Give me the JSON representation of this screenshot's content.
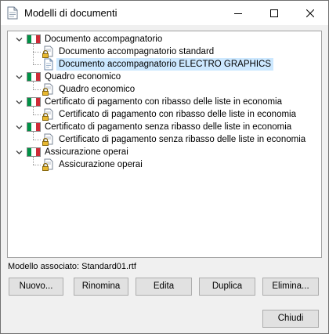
{
  "window": {
    "title": "Modelli di documenti",
    "icons": {
      "app": "document-icon",
      "minimize": "minimize-icon",
      "maximize": "maximize-icon",
      "close": "close-icon"
    }
  },
  "tree": {
    "groups": [
      {
        "label": "Documento accompagnatorio",
        "expanded": true,
        "children": [
          {
            "label": "Documento accompagnatorio standard",
            "icon": "locked-document-icon",
            "selected": false
          },
          {
            "label": "Documento accompagnatorio ELECTRO GRAPHICS",
            "icon": "document-icon",
            "selected": true
          }
        ]
      },
      {
        "label": "Quadro economico",
        "expanded": true,
        "children": [
          {
            "label": "Quadro economico",
            "icon": "locked-document-icon",
            "selected": false
          }
        ]
      },
      {
        "label": "Certificato di pagamento con ribasso delle liste in economia",
        "expanded": true,
        "children": [
          {
            "label": "Certificato di pagamento con ribasso delle liste in economia",
            "icon": "locked-document-icon",
            "selected": false
          }
        ]
      },
      {
        "label": "Certificato di pagamento senza ribasso delle liste in economia",
        "expanded": true,
        "children": [
          {
            "label": "Certificato di pagamento senza ribasso delle liste in economia",
            "icon": "locked-document-icon",
            "selected": false
          }
        ]
      },
      {
        "label": "Assicurazione operai",
        "expanded": true,
        "children": [
          {
            "label": "Assicurazione operai",
            "icon": "locked-document-icon",
            "selected": false
          }
        ]
      }
    ]
  },
  "status": {
    "text": "Modello associato: Standard01.rtf"
  },
  "buttons": {
    "nuovo": "Nuovo...",
    "rinomina": "Rinomina",
    "edita": "Edita",
    "duplica": "Duplica",
    "elimina": "Elimina...",
    "chiudi": "Chiudi"
  },
  "colors": {
    "selection": "#cce8ff",
    "flag_green": "#009246",
    "flag_white": "#ffffff",
    "flag_red": "#ce2b37",
    "button_face": "#e1e1e1"
  }
}
